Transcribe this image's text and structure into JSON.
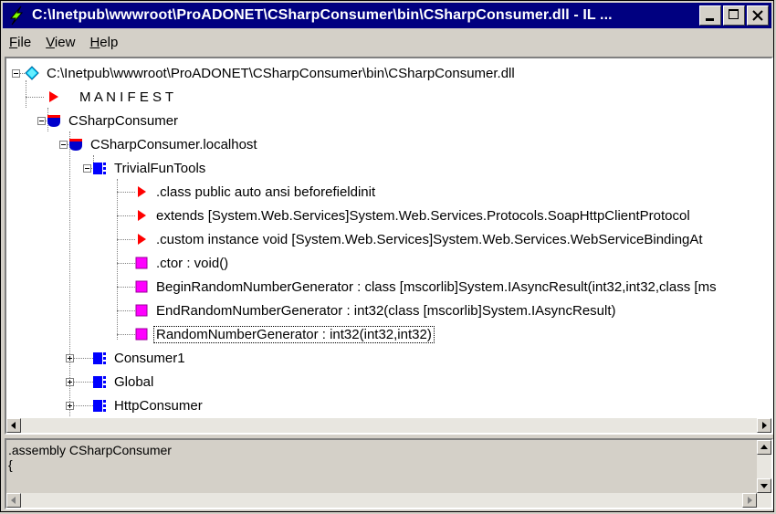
{
  "window": {
    "title": "C:\\Inetpub\\wwwroot\\ProADONET\\CSharpConsumer\\bin\\CSharpConsumer.dll - IL ..."
  },
  "menu": [
    {
      "underline": "F",
      "rest": "ile"
    },
    {
      "underline": "V",
      "rest": "iew"
    },
    {
      "underline": "H",
      "rest": "elp"
    }
  ],
  "tree": {
    "root": "C:\\Inetpub\\wwwroot\\ProADONET\\CSharpConsumer\\bin\\CSharpConsumer.dll",
    "manifest": "M A N I F E S T",
    "namespace": "CSharpConsumer",
    "localhost": "CSharpConsumer.localhost",
    "class": "TrivialFunTools",
    "members": [
      {
        "kind": "directive",
        "label": ".class public auto ansi beforefieldinit"
      },
      {
        "kind": "directive",
        "label": " extends [System.Web.Services]System.Web.Services.Protocols.SoapHttpClientProtocol"
      },
      {
        "kind": "directive",
        "label": ".custom instance void [System.Web.Services]System.Web.Services.WebServiceBindingAt"
      },
      {
        "kind": "method",
        "label": ".ctor : void()"
      },
      {
        "kind": "method",
        "label": "BeginRandomNumberGenerator : class [mscorlib]System.IAsyncResult(int32,int32,class [ms"
      },
      {
        "kind": "method",
        "label": "EndRandomNumberGenerator : int32(class [mscorlib]System.IAsyncResult)"
      },
      {
        "kind": "method",
        "label": "RandomNumberGenerator : int32(int32,int32)"
      }
    ],
    "siblings": [
      "Consumer1",
      "Global",
      "HttpConsumer"
    ]
  },
  "code_pane": {
    "line1": ".assembly CSharpConsumer",
    "line2": "{"
  },
  "colors": {
    "title_bg": "#000080",
    "chrome": "#d4d0c8",
    "directive_icon": "#ff0000",
    "method_icon": "#ff00ff",
    "class_icon": "#0000ff",
    "namespace_icon": "#0000cc"
  }
}
